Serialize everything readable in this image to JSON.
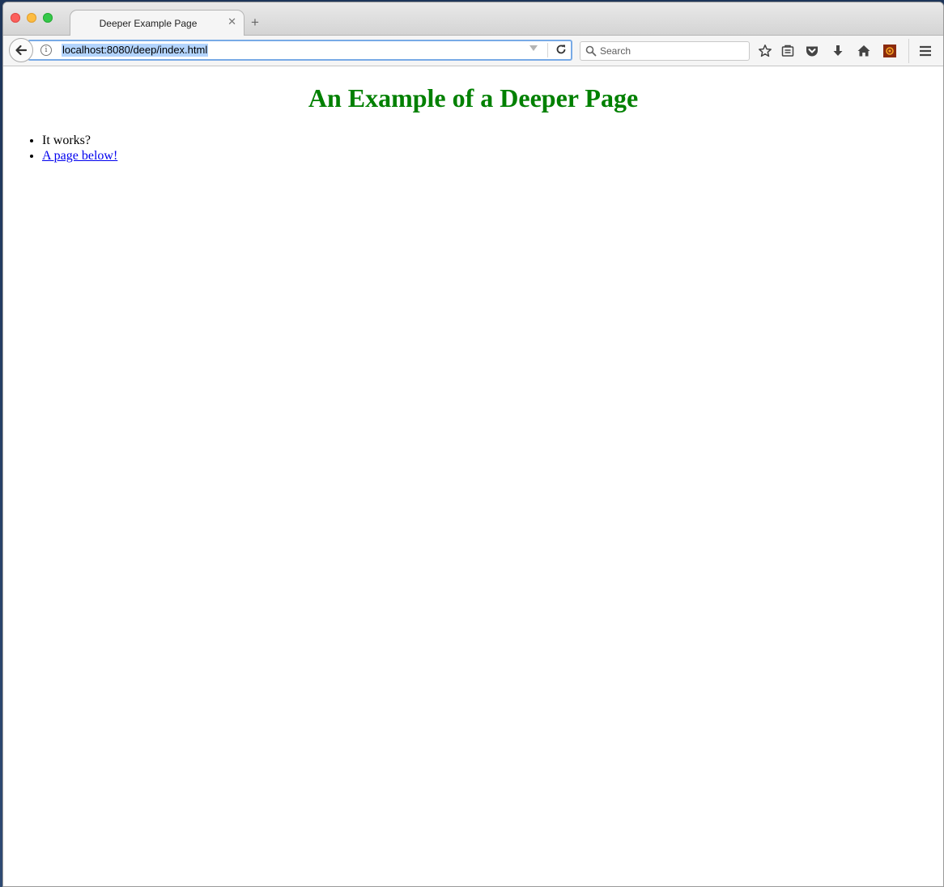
{
  "browser": {
    "tab": {
      "title": "Deeper Example Page",
      "close_glyph": "✕"
    },
    "new_tab_glyph": "+",
    "url": "localhost:8080/deep/index.html",
    "search": {
      "placeholder": "Search",
      "value": ""
    },
    "colors": {
      "url_focus": "#78aae6",
      "url_selection": "#b3d4fd",
      "sync_icon": "#e1701f"
    }
  },
  "page": {
    "heading": "An Example of a Deeper Page",
    "heading_color": "#008000",
    "items": [
      {
        "text": "It works?"
      },
      {
        "text": "A page below!",
        "is_link": true
      }
    ]
  }
}
